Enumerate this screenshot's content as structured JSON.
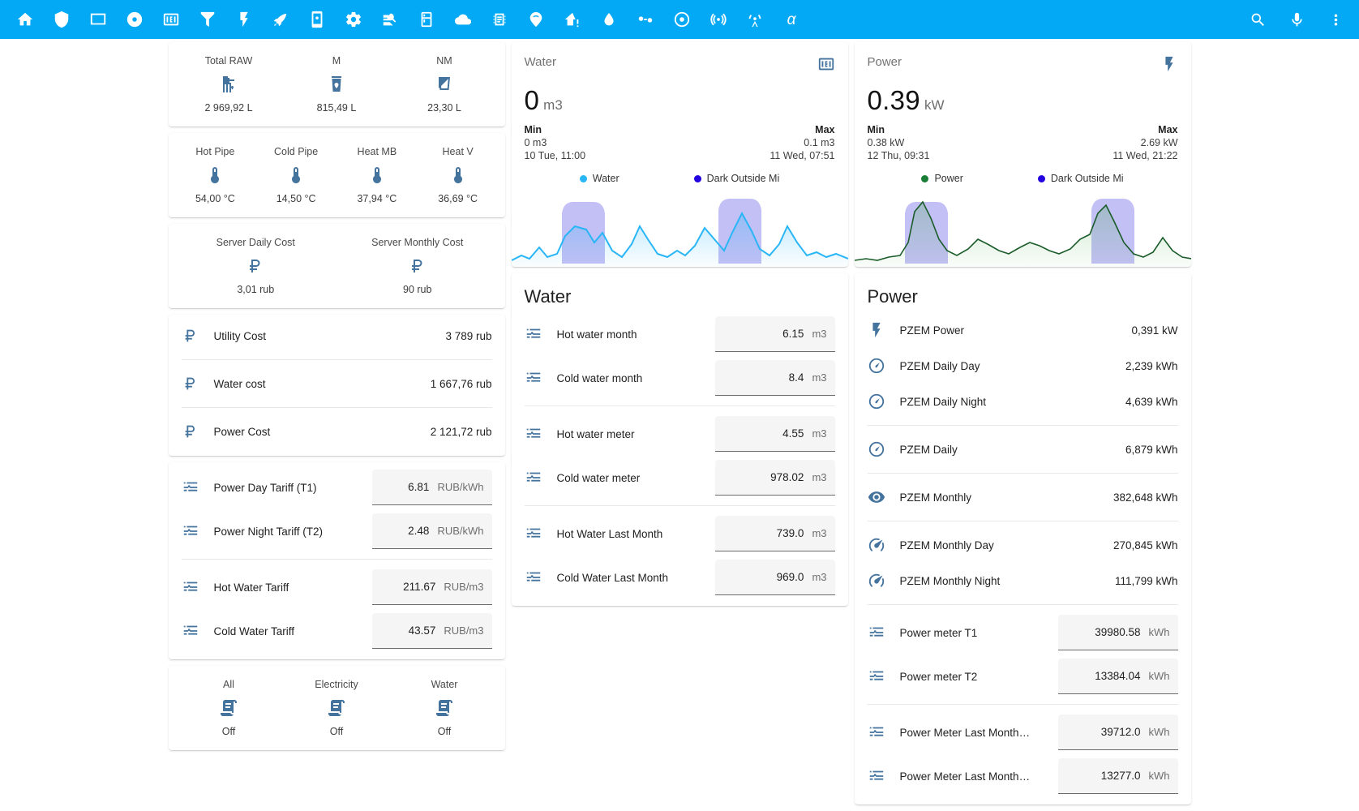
{
  "toolbar": {
    "icons": [
      {
        "name": "home-icon"
      },
      {
        "name": "shield-icon"
      },
      {
        "name": "tablet-icon"
      },
      {
        "name": "record-icon"
      },
      {
        "name": "counter-icon"
      },
      {
        "name": "filter-icon"
      },
      {
        "name": "flash-icon"
      },
      {
        "name": "rocket-icon"
      },
      {
        "name": "cellphone-cog-icon"
      },
      {
        "name": "cog-icon"
      },
      {
        "name": "heart-pulse-icon"
      },
      {
        "name": "fridge-icon"
      },
      {
        "name": "cloud-icon"
      },
      {
        "name": "chip-icon"
      },
      {
        "name": "wifi-marker-icon"
      },
      {
        "name": "home-alert-icon"
      },
      {
        "name": "water-icon"
      },
      {
        "name": "pipe-valve-icon"
      },
      {
        "name": "circle-target-icon"
      },
      {
        "name": "broadcast-icon"
      },
      {
        "name": "antenna-icon"
      },
      {
        "name": "alpha-icon"
      }
    ],
    "right_icons": [
      {
        "name": "search-icon"
      },
      {
        "name": "microphone-icon"
      },
      {
        "name": "overflow-menu-icon"
      }
    ],
    "accent_color": "#03a9f4"
  },
  "raw_glance": {
    "items": [
      {
        "name": "Total RAW",
        "icon": "water-pump-icon",
        "value": "2 969,92 L"
      },
      {
        "name": "M",
        "icon": "glass-water-icon",
        "value": "815,49 L"
      },
      {
        "name": "NM",
        "icon": "glass-empty-icon",
        "value": "23,30 L"
      }
    ]
  },
  "temp_glance": {
    "items": [
      {
        "name": "Hot Pipe",
        "icon": "thermometer-icon",
        "value": "54,00 °C"
      },
      {
        "name": "Cold Pipe",
        "icon": "thermometer-icon",
        "value": "14,50 °C"
      },
      {
        "name": "Heat MB",
        "icon": "thermometer-icon",
        "value": "37,94 °C"
      },
      {
        "name": "Heat V",
        "icon": "thermometer-icon",
        "value": "36,69 °C"
      }
    ]
  },
  "server_glance": {
    "items": [
      {
        "name": "Server Daily Cost",
        "icon": "ruble-icon",
        "value": "3,01 rub"
      },
      {
        "name": "Server Monthly Cost",
        "icon": "ruble-icon",
        "value": "90 rub"
      }
    ]
  },
  "cost_entities": {
    "rows": [
      {
        "icon": "ruble-icon",
        "name": "Utility Cost",
        "value": "3 789 rub"
      },
      {
        "icon": "ruble-icon",
        "name": "Water cost",
        "value": "1 667,76 rub"
      },
      {
        "icon": "ruble-icon",
        "name": "Power Cost",
        "value": "2 121,72 rub"
      }
    ]
  },
  "tariff_entities": {
    "rows": [
      {
        "icon": "tune-icon",
        "name": "Power Day Tariff (T1)",
        "value": "6.81",
        "unit": "RUB/kWh"
      },
      {
        "icon": "tune-icon",
        "name": "Power Night Tariff (T2)",
        "value": "2.48",
        "unit": "RUB/kWh"
      },
      {
        "icon": "tune-icon",
        "name": "Hot Water Tariff",
        "value": "211.67",
        "unit": "RUB/m3"
      },
      {
        "icon": "tune-icon",
        "name": "Cold Water Tariff",
        "value": "43.57",
        "unit": "RUB/m3"
      }
    ]
  },
  "switch_glance": {
    "items": [
      {
        "name": "All",
        "icon": "script-text-icon",
        "value": "Off"
      },
      {
        "name": "Electricity",
        "icon": "script-text-icon",
        "value": "Off"
      },
      {
        "name": "Water",
        "icon": "script-text-icon",
        "value": "Off"
      }
    ]
  },
  "water_stat": {
    "title": "Water",
    "icon": "counter-icon",
    "value": "0",
    "unit": "m3",
    "min_label": "Min",
    "min_value": "0 m3",
    "min_time": "10 Tue, 11:00",
    "max_label": "Max",
    "max_value": "0.1 m3",
    "max_time": "11 Wed, 07:51",
    "legend": [
      {
        "label": "Water",
        "color": "#29b6f6"
      },
      {
        "label": "Dark Outside Mi",
        "color": "#2200e0"
      }
    ]
  },
  "power_stat": {
    "title": "Power",
    "icon": "flash-icon",
    "value": "0.39",
    "unit": "kW",
    "min_label": "Min",
    "min_value": "0.38 kW",
    "min_time": "12 Thu, 09:31",
    "max_label": "Max",
    "max_value": "2.69 kW",
    "max_time": "11 Wed, 21:22",
    "legend": [
      {
        "label": "Power",
        "color": "#1a7d36"
      },
      {
        "label": "Dark Outside Mi",
        "color": "#2200e0"
      }
    ]
  },
  "water_section": {
    "title": "Water",
    "rows": [
      {
        "icon": "tune-icon",
        "name": "Hot water month",
        "value": "6.15",
        "unit": "m3"
      },
      {
        "icon": "tune-icon",
        "name": "Cold water month",
        "value": "8.4",
        "unit": "m3"
      },
      {
        "icon": "tune-icon",
        "name": "Hot water meter",
        "value": "4.55",
        "unit": "m3"
      },
      {
        "icon": "tune-icon",
        "name": "Cold water meter",
        "value": "978.02",
        "unit": "m3"
      },
      {
        "icon": "tune-icon",
        "name": "Hot Water Last Month",
        "value": "739.0",
        "unit": "m3"
      },
      {
        "icon": "tune-icon",
        "name": "Cold Water Last Month",
        "value": "969.0",
        "unit": "m3"
      }
    ]
  },
  "power_section": {
    "title": "Power",
    "rows": [
      {
        "icon": "flash-icon",
        "name": "PZEM Power",
        "value": "0,391 kW"
      },
      {
        "icon": "gauge-icon",
        "name": "PZEM Daily Day",
        "value": "2,239 kWh"
      },
      {
        "icon": "gauge-icon",
        "name": "PZEM Daily Night",
        "value": "4,639 kWh"
      },
      {
        "icon": "gauge-icon",
        "name": "PZEM Daily",
        "value": "6,879 kWh"
      },
      {
        "icon": "eye-icon",
        "name": "PZEM Monthly",
        "value": "382,648 kWh"
      },
      {
        "icon": "speedometer-icon",
        "name": "PZEM Monthly Day",
        "value": "270,845 kWh"
      },
      {
        "icon": "speedometer-icon",
        "name": "PZEM Monthly Night",
        "value": "111,799 kWh"
      }
    ],
    "meter_rows": [
      {
        "icon": "tune-icon",
        "name": "Power meter T1",
        "value": "39980.58",
        "unit": "kWh"
      },
      {
        "icon": "tune-icon",
        "name": "Power meter T2",
        "value": "13384.04",
        "unit": "kWh"
      },
      {
        "icon": "tune-icon",
        "name": "Power Meter Last Month…",
        "value": "39712.0",
        "unit": "kWh"
      },
      {
        "icon": "tune-icon",
        "name": "Power Meter Last Month…",
        "value": "13277.0",
        "unit": "kWh"
      }
    ]
  }
}
